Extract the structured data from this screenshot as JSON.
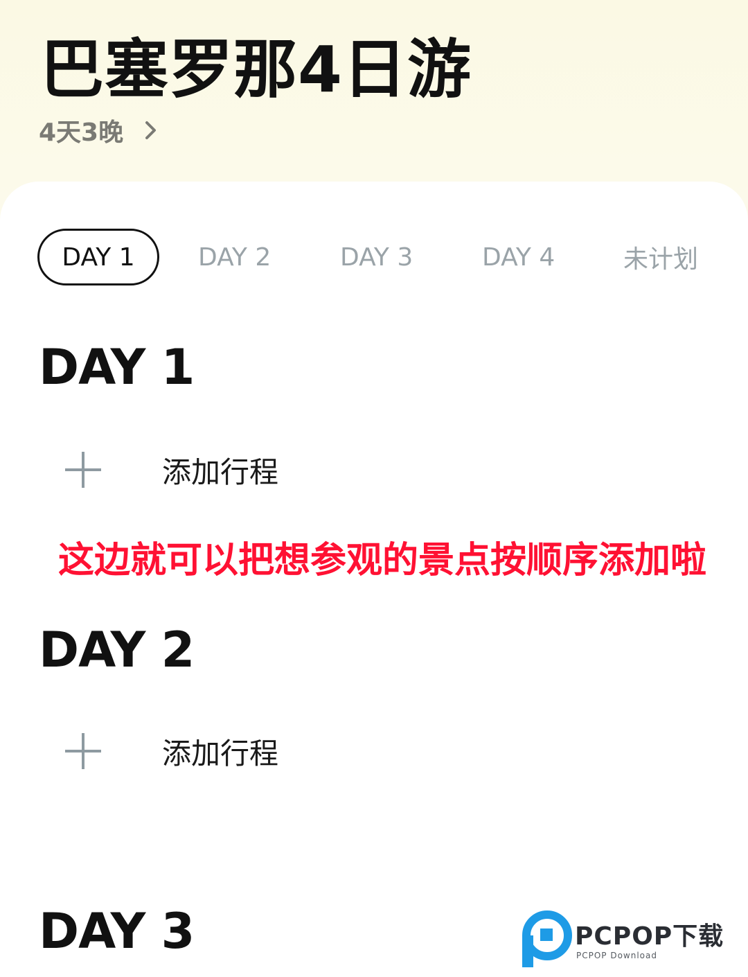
{
  "header": {
    "title": "巴塞罗那4日游",
    "duration": "4天3晚"
  },
  "tabs": [
    {
      "label": "DAY 1",
      "active": true
    },
    {
      "label": "DAY 2",
      "active": false
    },
    {
      "label": "DAY 3",
      "active": false
    },
    {
      "label": "DAY 4",
      "active": false
    },
    {
      "label": "未计划",
      "active": false
    }
  ],
  "days": [
    {
      "heading": "DAY 1",
      "add_label": "添加行程"
    },
    {
      "heading": "DAY 2",
      "add_label": "添加行程"
    },
    {
      "heading": "DAY 3"
    }
  ],
  "annotation": "这边就可以把想参观的景点按顺序添加啦",
  "watermark": {
    "brand": "PCPOP下载",
    "sub": "PCPOP Download"
  },
  "icons": {
    "chevron": "chevron-right-icon",
    "add": "plus-icon",
    "logo": "pcpop-logo"
  },
  "colors": {
    "header_bg": "#fbf9e4",
    "active_tab": "#111111",
    "inactive_tab": "#9aa3a8",
    "annotation": "#ff1133",
    "watermark_blue": "#1e9be6"
  }
}
